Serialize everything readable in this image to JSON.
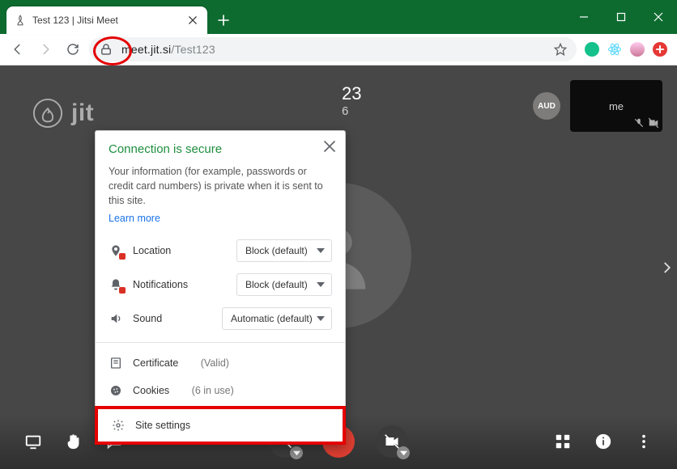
{
  "window": {
    "tab_title": "Test 123 | Jitsi Meet"
  },
  "url": {
    "host": "meet.jit.si",
    "path": "/Test123"
  },
  "panel": {
    "title": "Connection is secure",
    "description": "Your information (for example, passwords or credit card numbers) is private when it is sent to this site.",
    "learn_more": "Learn more",
    "permissions": {
      "location": {
        "label": "Location",
        "value": "Block (default)"
      },
      "notifications": {
        "label": "Notifications",
        "value": "Block (default)"
      },
      "sound": {
        "label": "Sound",
        "value": "Automatic (default)"
      }
    },
    "certificate": {
      "label": "Certificate",
      "status": "(Valid)"
    },
    "cookies": {
      "label": "Cookies",
      "status": "(6 in use)"
    },
    "site_settings": {
      "label": "Site settings"
    }
  },
  "meet": {
    "brand": "jit",
    "room_suffix": "23",
    "sub_suffix": "6",
    "aud_badge": "AUD",
    "me_label": "me"
  }
}
